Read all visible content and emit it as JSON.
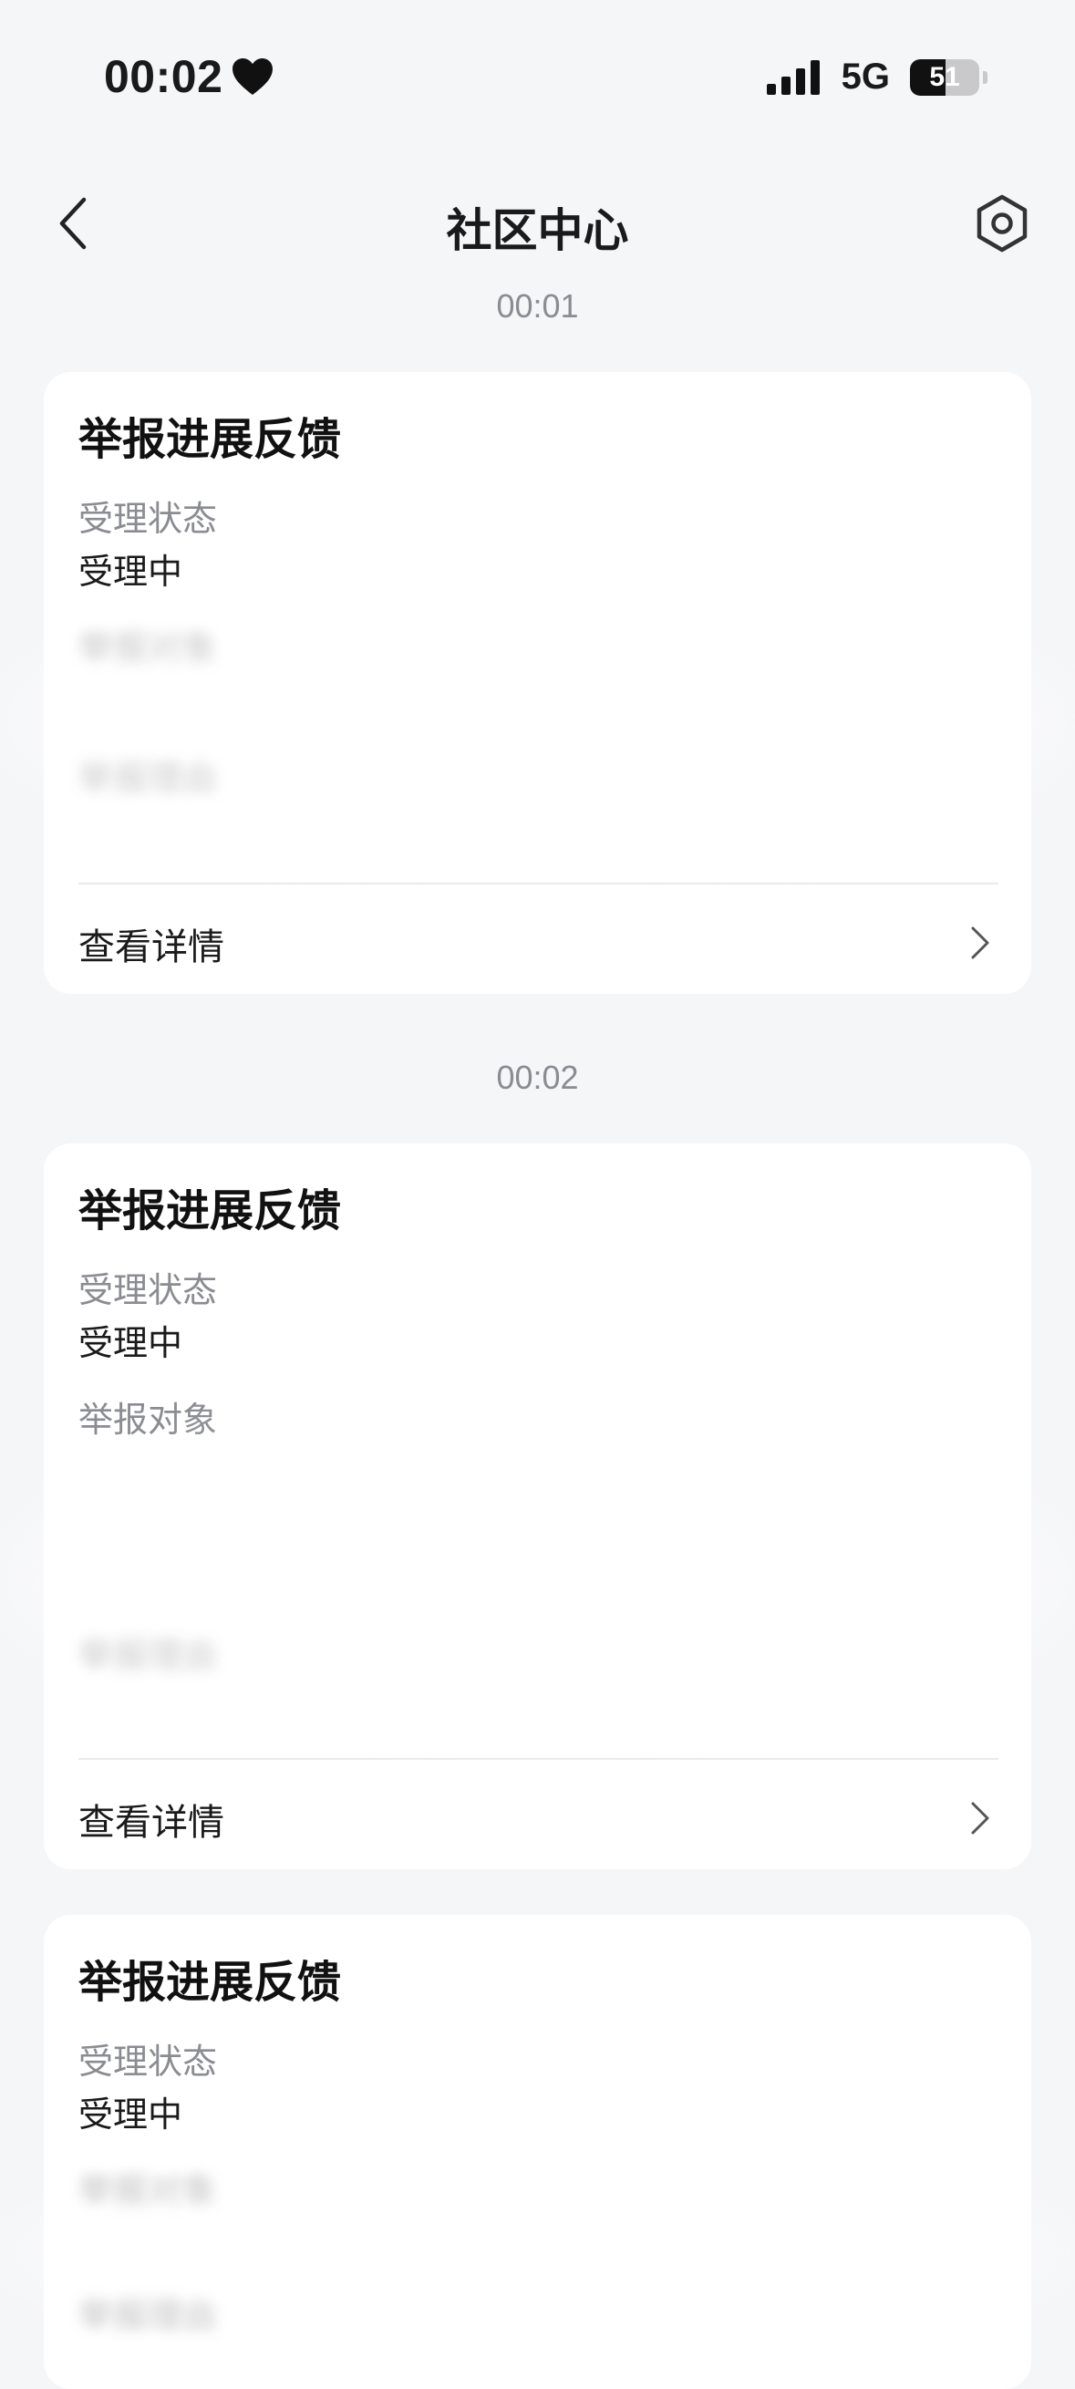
{
  "status_bar": {
    "time": "00:02",
    "network": "5G",
    "battery": "51",
    "battery_level": 0.51
  },
  "nav": {
    "title": "社区中心"
  },
  "feed": [
    {
      "timestamp": "00:01",
      "title": "举报进展反馈",
      "status_label": "受理状态",
      "status_value": "受理中",
      "target_label": "举报对象",
      "target_value": "",
      "reason_label": "举报理由",
      "reason_value": "",
      "detail_label": "查看详情"
    },
    {
      "timestamp": "00:02",
      "title": "举报进展反馈",
      "status_label": "受理状态",
      "status_value": "受理中",
      "target_label": "举报对象",
      "target_value": "",
      "reason_label": "举报理由",
      "reason_value": "",
      "detail_label": "查看详情"
    },
    {
      "title": "举报进展反馈",
      "status_label": "受理状态",
      "status_value": "受理中",
      "target_label": "举报对象",
      "reason_label": "举报理由"
    }
  ]
}
